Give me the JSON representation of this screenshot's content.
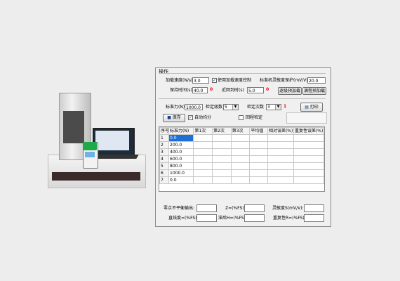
{
  "group": {
    "title": "操作"
  },
  "row1": {
    "load_speed_label": "加载速度(N/s)",
    "load_speed_value": "3.0",
    "use_speed_ctrl_label": "使用加载速度控制",
    "use_speed_ctrl_checked": true,
    "sensitivity_label": "标准机灵敏度保护(mV/V)",
    "sensitivity_value": "20.0"
  },
  "row2": {
    "hold_time_label": "保持时间(s)",
    "hold_time_value": "40.0",
    "zero_time_label": "近回到时(s)",
    "zero_time_value": "5.0",
    "preload_button": "逐级预加载",
    "full_preload_button": "满程预加载"
  },
  "row3": {
    "std_force_label": "标准力(N)",
    "std_force_value": "1000.0",
    "levels_label": "检定级数",
    "levels_value": "5",
    "times_label": "检定次数",
    "times_value": "3",
    "print_button": "打印"
  },
  "row4": {
    "save_button": "保存",
    "auto_avg_label": "自动均分",
    "auto_avg_checked": true,
    "return_check_label": "回程检定",
    "return_check_checked": false
  },
  "markers": {
    "required": "0",
    "required2": "0",
    "required3": "1"
  },
  "grid": {
    "columns": [
      "序号",
      "标准力(N)",
      "第1次",
      "第2次",
      "第3次",
      "平均值",
      "相对误差(%)",
      "重复性误差(%)"
    ],
    "rows": [
      [
        "1",
        "0.0",
        "",
        "",
        "",
        "",
        "",
        ""
      ],
      [
        "2",
        "200.0",
        "",
        "",
        "",
        "",
        "",
        ""
      ],
      [
        "3",
        "400.0",
        "",
        "",
        "",
        "",
        "",
        ""
      ],
      [
        "4",
        "600.0",
        "",
        "",
        "",
        "",
        "",
        ""
      ],
      [
        "5",
        "800.0",
        "",
        "",
        "",
        "",
        "",
        ""
      ],
      [
        "6",
        "1000.0",
        "",
        "",
        "",
        "",
        "",
        ""
      ],
      [
        "7",
        "0.0",
        "",
        "",
        "",
        "",
        "",
        ""
      ]
    ]
  },
  "results": {
    "zero_output_label": "零点不平衡输出:",
    "z_label": "Z=(%FS):",
    "sensitivity_label": "灵敏度S(mV/V):",
    "linearity_label": "直线度=(%FS):",
    "hysteresis_label": "滞后H=(%FS):",
    "repeat_label": "重复性R=(%FS):"
  },
  "colors": {
    "selection": "#1f6fd6",
    "marker": "#e00000"
  }
}
